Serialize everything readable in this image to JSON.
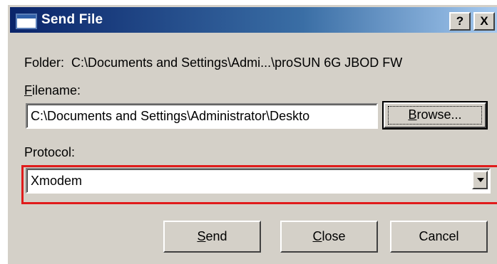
{
  "dialog": {
    "title": "Send File",
    "help_glyph": "?",
    "close_glyph": "X"
  },
  "folder": {
    "label": "Folder:",
    "value": "C:\\Documents and Settings\\Admi...\\proSUN 6G JBOD FW"
  },
  "filename": {
    "label_accel": "F",
    "label_rest": "ilename:",
    "value": "C:\\Documents and Settings\\Administrator\\Deskto"
  },
  "browse_button": {
    "accel": "B",
    "rest": "rowse..."
  },
  "protocol": {
    "label": "Protocol:",
    "selected": "Xmodem"
  },
  "buttons": {
    "send_accel": "S",
    "send_rest": "end",
    "close_accel": "C",
    "close_rest": "lose",
    "cancel": "Cancel"
  },
  "colors": {
    "titlebar_start": "#0a246a",
    "titlebar_end": "#a6caf0",
    "dialog_face": "#d4d0c8",
    "highlight_box": "#e01b1b"
  }
}
